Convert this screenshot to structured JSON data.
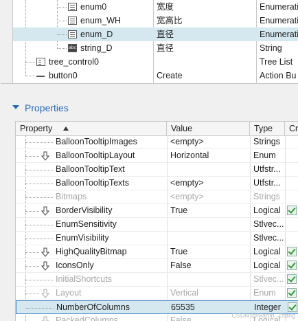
{
  "tree": {
    "rows": [
      {
        "name": "enum0",
        "value": "宽度",
        "type": "Enumerati",
        "icon": "list-icon",
        "selected": false
      },
      {
        "name": "enum_WH",
        "value": "宽高比",
        "type": "Enumerati",
        "icon": "list-icon",
        "selected": false
      },
      {
        "name": "enum_D",
        "value": "直径",
        "type": "Enumerati",
        "icon": "list-icon",
        "selected": true
      },
      {
        "name": "string_D",
        "value": "直径",
        "type": "String",
        "icon": "text-icon",
        "selected": false
      },
      {
        "name": "tree_control0",
        "value": "",
        "type": "Tree List",
        "icon": "tree-icon",
        "selected": false
      },
      {
        "name": "button0",
        "value": "Create",
        "type": "Action Bu",
        "icon": "button-icon",
        "selected": false
      }
    ],
    "abc_glyph": "abc"
  },
  "properties": {
    "title": "Properties",
    "columns": {
      "property": "Property",
      "value": "Value",
      "type": "Type",
      "extra": "Cr"
    },
    "rows": [
      {
        "name": "BalloonTooltipImages",
        "value": "<empty>",
        "type": "Strings",
        "arrow": false,
        "disabled": false,
        "check": false
      },
      {
        "name": "BalloonTooltipLayout",
        "value": "Horizontal",
        "type": "Enum",
        "arrow": true,
        "disabled": false,
        "check": false
      },
      {
        "name": "BalloonTooltipText",
        "value": "",
        "type": "Utfstr...",
        "arrow": false,
        "disabled": false,
        "check": false
      },
      {
        "name": "BalloonTooltipTexts",
        "value": "<empty>",
        "type": "Utfstr...",
        "arrow": false,
        "disabled": false,
        "check": false
      },
      {
        "name": "Bitmaps",
        "value": "<empty>",
        "type": "Strings",
        "arrow": false,
        "disabled": true,
        "check": false
      },
      {
        "name": "BorderVisibility",
        "value": "True",
        "type": "Logical",
        "arrow": true,
        "disabled": false,
        "check": true
      },
      {
        "name": "EnumSensitivity",
        "value": "",
        "type": "Stlvec...",
        "arrow": false,
        "disabled": false,
        "check": false
      },
      {
        "name": "EnumVisibility",
        "value": "",
        "type": "Stlvec...",
        "arrow": false,
        "disabled": false,
        "check": false
      },
      {
        "name": "HighQualityBitmap",
        "value": "True",
        "type": "Logical",
        "arrow": true,
        "disabled": false,
        "check": true
      },
      {
        "name": "IconsOnly",
        "value": "False",
        "type": "Logical",
        "arrow": true,
        "disabled": false,
        "check": true
      },
      {
        "name": "InitialShortcuts",
        "value": "",
        "type": "Stlvec...",
        "arrow": false,
        "disabled": true,
        "check": true
      },
      {
        "name": "Layout",
        "value": "Vertical",
        "type": "Enum",
        "arrow": true,
        "disabled": true,
        "check": true
      },
      {
        "name": "NumberOfColumns",
        "value": "65535",
        "type": "Integer",
        "arrow": false,
        "disabled": false,
        "check": true,
        "selected": true
      },
      {
        "name": "PackedColumns",
        "value": "False",
        "type": "Logical",
        "arrow": true,
        "disabled": true,
        "check": false
      }
    ]
  },
  "watermark": "CSDN @Martin_Zhang"
}
